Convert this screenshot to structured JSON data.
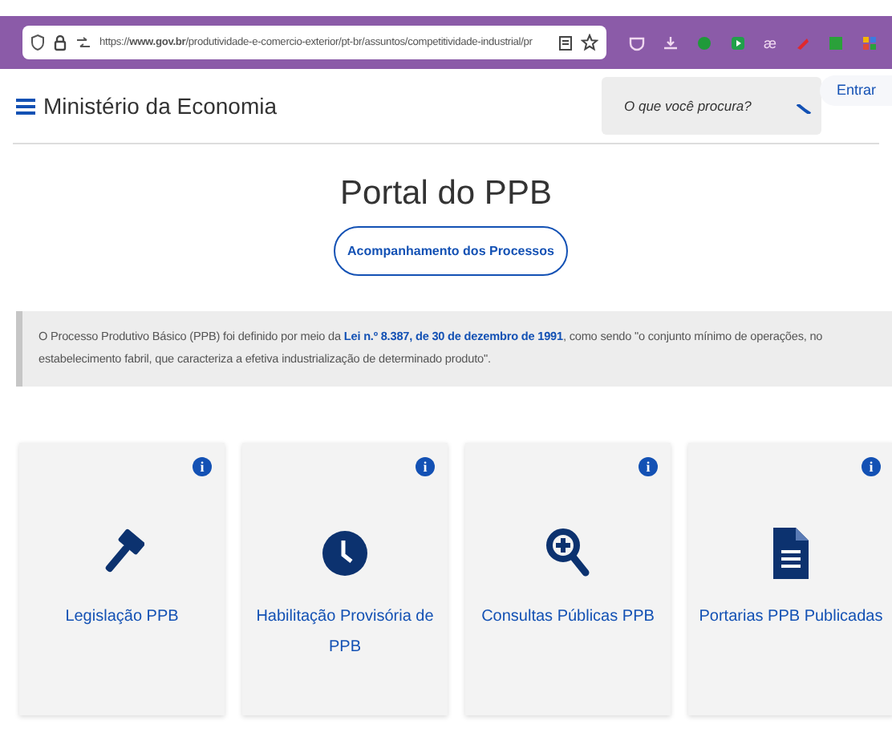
{
  "browser": {
    "url": "https://**www.gov.br**/produtividade-e-comercio-exterior/pt-br/assuntos/competitividade-industrial/pr",
    "extension_text": "æ"
  },
  "header": {
    "site_title": "Ministério da Economia",
    "search": {
      "placeholder": "O que você procura?"
    },
    "login_button": "Entrar"
  },
  "page_title": "Portal do PPB",
  "process_button": "Acompanhamento dos Processos",
  "notice": {
    "text": "O Processo Produtivo Básico (PPB) foi definido por meio da ",
    "link": "Lei n.º 8.387, de 30 de dezembro de 1991",
    "text_after": ", como sendo \"o conjunto mínimo de operações, no estabelecimento fabril, que caracteriza a efetiva industrialização de determinado produto\"."
  },
  "cards": [
    {
      "kind": "gavel",
      "label": "Legislação PPB",
      "info": "i"
    },
    {
      "kind": "clock",
      "label": "Habilitação Provisória de PPB",
      "info": "i"
    },
    {
      "kind": "zoom",
      "label": "Consultas Públicas PPB",
      "info": "i"
    },
    {
      "kind": "document",
      "label": "Portarias PPB Publicadas",
      "info": "i"
    }
  ]
}
